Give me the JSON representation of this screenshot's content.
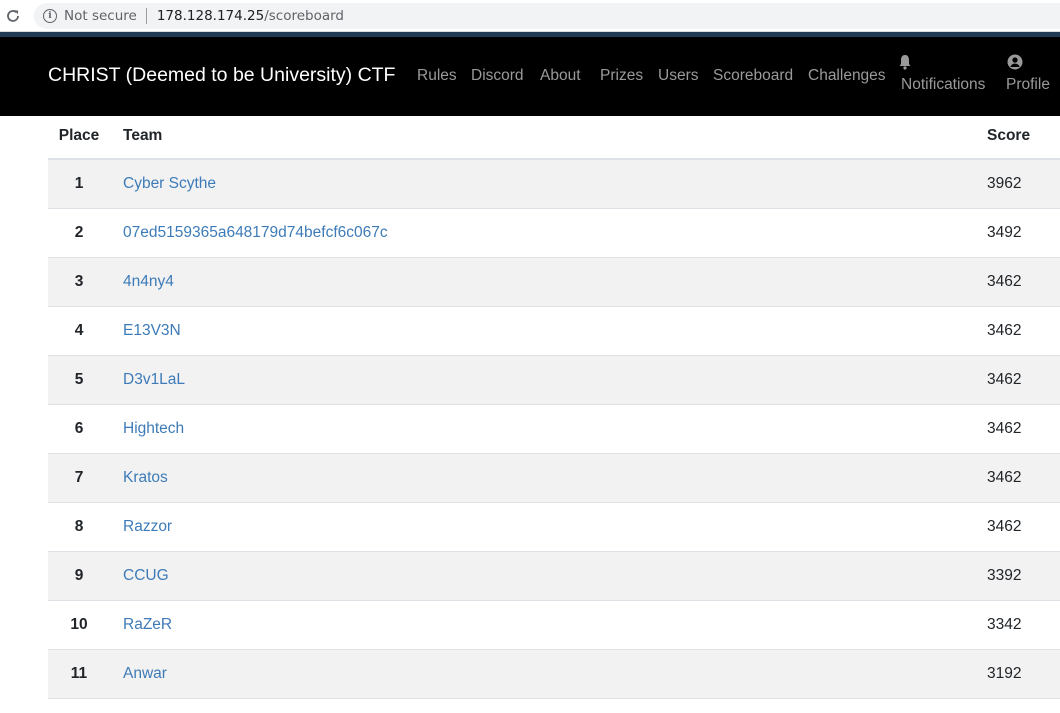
{
  "browser": {
    "security_label": "Not secure",
    "url_host": "178.128.174.25",
    "url_path": "/scoreboard"
  },
  "navbar": {
    "brand": "CHRIST (Deemed to be University) CTF",
    "links": [
      {
        "label": "Rules"
      },
      {
        "label": "Discord"
      },
      {
        "label": "About"
      },
      {
        "label": "Prizes"
      },
      {
        "label": "Users"
      },
      {
        "label": "Scoreboard"
      },
      {
        "label": "Challenges"
      }
    ],
    "notifications_label": "Notifications",
    "profile_label": "Profile"
  },
  "scoreboard": {
    "headers": {
      "place": "Place",
      "team": "Team",
      "score": "Score"
    },
    "rows": [
      {
        "place": "1",
        "team": "Cyber Scythe",
        "score": "3962"
      },
      {
        "place": "2",
        "team": "07ed5159365a648179d74befcf6c067c",
        "score": "3492"
      },
      {
        "place": "3",
        "team": "4n4ny4",
        "score": "3462"
      },
      {
        "place": "4",
        "team": "E13V3N",
        "score": "3462"
      },
      {
        "place": "5",
        "team": "D3v1LaL",
        "score": "3462"
      },
      {
        "place": "6",
        "team": "Hightech",
        "score": "3462"
      },
      {
        "place": "7",
        "team": "Kratos",
        "score": "3462"
      },
      {
        "place": "8",
        "team": "Razzor",
        "score": "3462"
      },
      {
        "place": "9",
        "team": "CCUG",
        "score": "3392"
      },
      {
        "place": "10",
        "team": "RaZeR",
        "score": "3342"
      },
      {
        "place": "11",
        "team": "Anwar",
        "score": "3192"
      }
    ]
  },
  "colors": {
    "navbar_bg": "#000000",
    "nav_link": "#9a9a9a",
    "team_link": "#3d7bb8",
    "stripe_row": "#f2f2f2"
  }
}
